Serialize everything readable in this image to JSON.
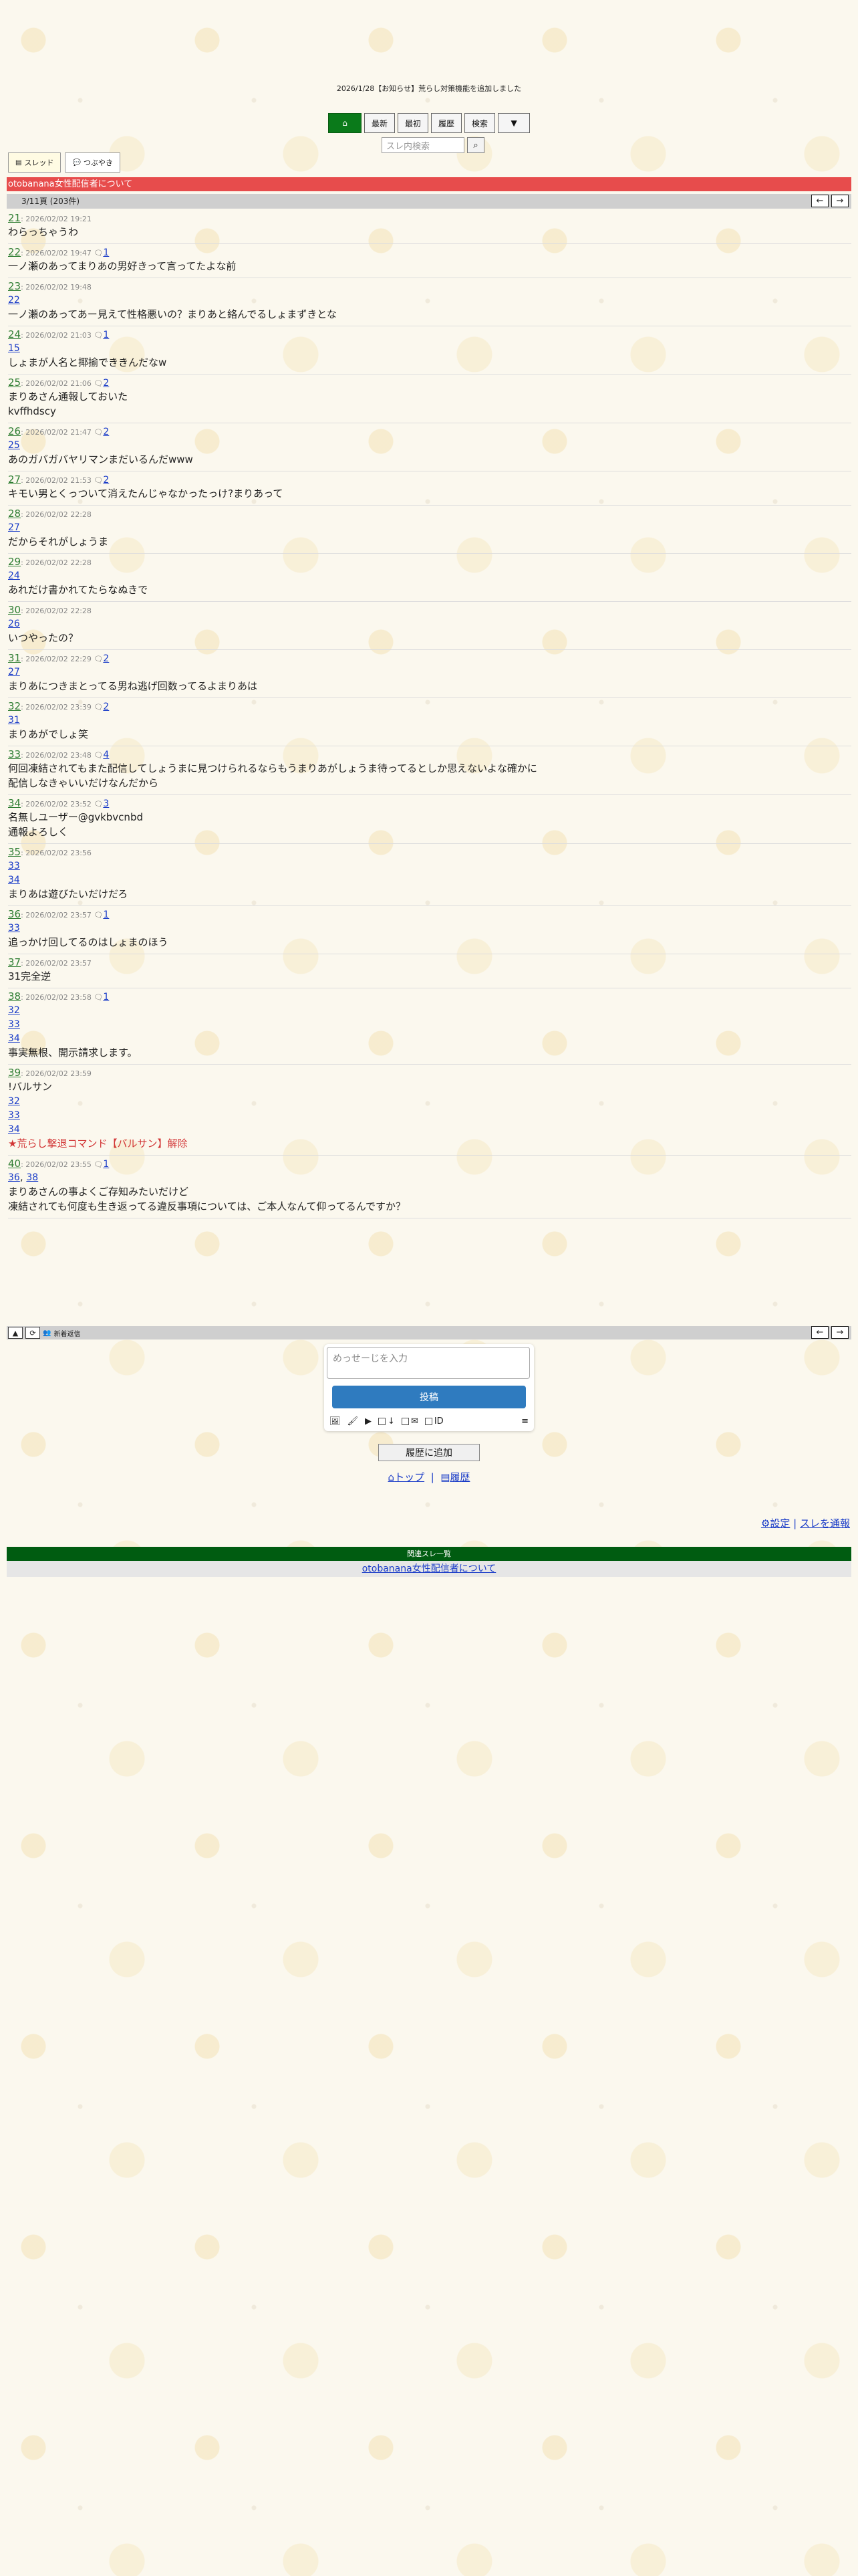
{
  "announcement": "2026/1/28【お知らせ】荒らし対策機能を追加しました",
  "nav": {
    "home_icon": "home-icon",
    "latest": "最新",
    "first": "最初",
    "history": "履歴",
    "search": "検索",
    "menu_glyph": "▼"
  },
  "search": {
    "placeholder": "スレ内検索"
  },
  "tabs": {
    "thread": "スレッド",
    "tsubuyaki": "つぶやき"
  },
  "thread_title": "otobanana女性配信者について",
  "page_info": "3/11頁 (203件)",
  "posts": [
    {
      "num": "21",
      "date": "2026/02/02 19:21",
      "replies": "",
      "refs": [],
      "body": "わらっちゃうわ"
    },
    {
      "num": "22",
      "date": "2026/02/02 19:47",
      "replies": "1",
      "refs": [],
      "body": "一ノ瀬のあってまりあの男好きって言ってたよな前"
    },
    {
      "num": "23",
      "date": "2026/02/02 19:48",
      "replies": "",
      "refs": [
        "22"
      ],
      "body": "一ノ瀬のあってあー見えて性格悪いの？まりあと絡んでるしょまずきとな"
    },
    {
      "num": "24",
      "date": "2026/02/02 21:03",
      "replies": "1",
      "refs": [
        "15"
      ],
      "body": "しょまが人名と揶揄でききんだなw"
    },
    {
      "num": "25",
      "date": "2026/02/02 21:06",
      "replies": "2",
      "refs": [],
      "body": "まりあさん通報しておいた\nkvffhdscy"
    },
    {
      "num": "26",
      "date": "2026/02/02 21:47",
      "replies": "2",
      "refs": [
        "25"
      ],
      "body": "あのガバガバヤリマンまだいるんだwww"
    },
    {
      "num": "27",
      "date": "2026/02/02 21:53",
      "replies": "2",
      "refs": [],
      "body": "キモい男とくっついて消えたんじゃなかったっけ?まりあって"
    },
    {
      "num": "28",
      "date": "2026/02/02 22:28",
      "replies": "",
      "refs": [
        "27"
      ],
      "body": "だからそれがしょうま"
    },
    {
      "num": "29",
      "date": "2026/02/02 22:28",
      "replies": "",
      "refs": [
        "24"
      ],
      "body": "あれだけ書かれてたらなぬきで"
    },
    {
      "num": "30",
      "date": "2026/02/02 22:28",
      "replies": "",
      "refs": [
        "26"
      ],
      "body": "いつやったの？"
    },
    {
      "num": "31",
      "date": "2026/02/02 22:29",
      "replies": "2",
      "refs": [
        "27"
      ],
      "body": "まりあにつきまとってる男ね逃げ回数ってるよまりあは"
    },
    {
      "num": "32",
      "date": "2026/02/02 23:39",
      "replies": "2",
      "refs": [
        "31"
      ],
      "body": "まりあがでしょ笑"
    },
    {
      "num": "33",
      "date": "2026/02/02 23:48",
      "replies": "4",
      "refs": [],
      "body": "何回凍結されてもまた配信してしょうまに見つけられるならもうまりあがしょうま待ってるとしか思えないよな確かに\n配信しなきゃいいだけなんだから"
    },
    {
      "num": "34",
      "date": "2026/02/02 23:52",
      "replies": "3",
      "refs": [],
      "body": "名無しユーザー@gvkbvcnbd\n通報よろしく"
    },
    {
      "num": "35",
      "date": "2026/02/02 23:56",
      "replies": "",
      "refs": [
        "33",
        "34"
      ],
      "body": "まりあは遊びたいだけだろ"
    },
    {
      "num": "36",
      "date": "2026/02/02 23:57",
      "replies": "1",
      "refs": [
        "33"
      ],
      "body": "追っかけ回してるのはしょまのほう"
    },
    {
      "num": "37",
      "date": "2026/02/02 23:57",
      "replies": "",
      "refs": [],
      "body": "31完全逆",
      "ref_inline": "31"
    },
    {
      "num": "38",
      "date": "2026/02/02 23:58",
      "replies": "1",
      "refs": [
        "32",
        "33",
        "34"
      ],
      "body": "事実無根、開示請求します。"
    },
    {
      "num": "39",
      "date": "2026/02/02 23:59",
      "replies": "",
      "refs": [],
      "body": "!バルサン",
      "refs2": [
        "32",
        "33",
        "34"
      ],
      "alert": "★荒らし撃退コマンド【バルサン】解除"
    },
    {
      "num": "40",
      "date": "2026/02/02 23:55",
      "replies": "1",
      "refs": [],
      "multi_refs": [
        "36",
        "38"
      ],
      "body": "まりあさんの事よくご存知みたいだけど\n凍結されても何度も生き返ってる違反事項については、ご本人なんて仰ってるんですか？"
    }
  ],
  "bottombar": {
    "label": "新着返信"
  },
  "form": {
    "placeholder": "めっせーじを入力",
    "submit": "投稿",
    "opt_sage": "↓",
    "opt_mail": "✉",
    "opt_id": "ID"
  },
  "add_history": "履歴に追加",
  "footer": {
    "top": "トップ",
    "history": "履歴",
    "settings": "設定",
    "report": "スレを通報"
  },
  "related": {
    "heading": "関連スレ一覧",
    "link": "otobanana女性配信者について"
  }
}
